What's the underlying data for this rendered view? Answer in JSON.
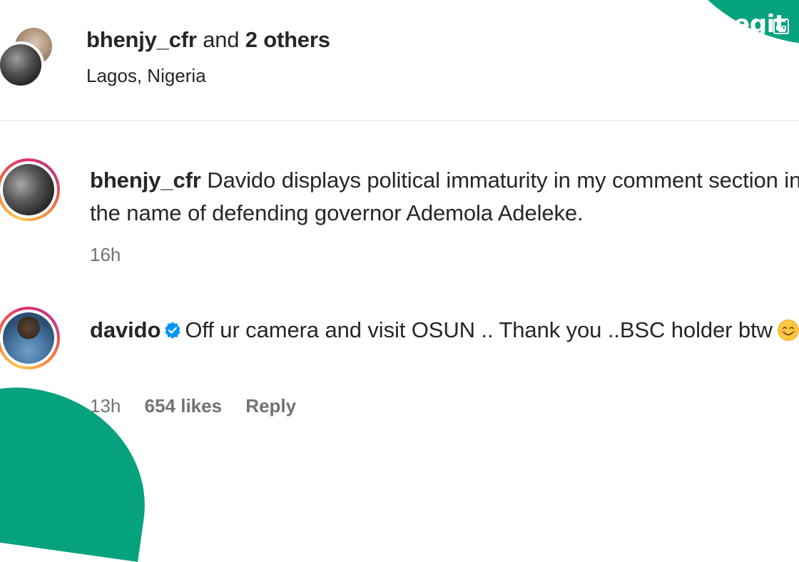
{
  "header": {
    "username": "bhenjy_cfr",
    "conjunction": "and",
    "others": "2 others",
    "location": "Lagos, Nigeria"
  },
  "logo": {
    "text": "Legit",
    "badge": "ng",
    "color": "#06a27d"
  },
  "comments": [
    {
      "username": "bhenjy_cfr",
      "text": "Davido displays political immaturity in my comment section in the name of defending governor Ademola Adeleke.",
      "time": "16h"
    },
    {
      "username": "davido",
      "verified_icon": "verified-badge-icon",
      "text": "Off ur camera and visit OSUN .. Thank you ..BSC holder btw",
      "emoji": "smiling-face-icon",
      "time": "13h",
      "likes": "654 likes",
      "reply_label": "Reply"
    }
  ],
  "colors": {
    "accent": "#06a27d",
    "verified": "#0095f6",
    "meta_text": "#737373",
    "primary_text": "#262626"
  }
}
